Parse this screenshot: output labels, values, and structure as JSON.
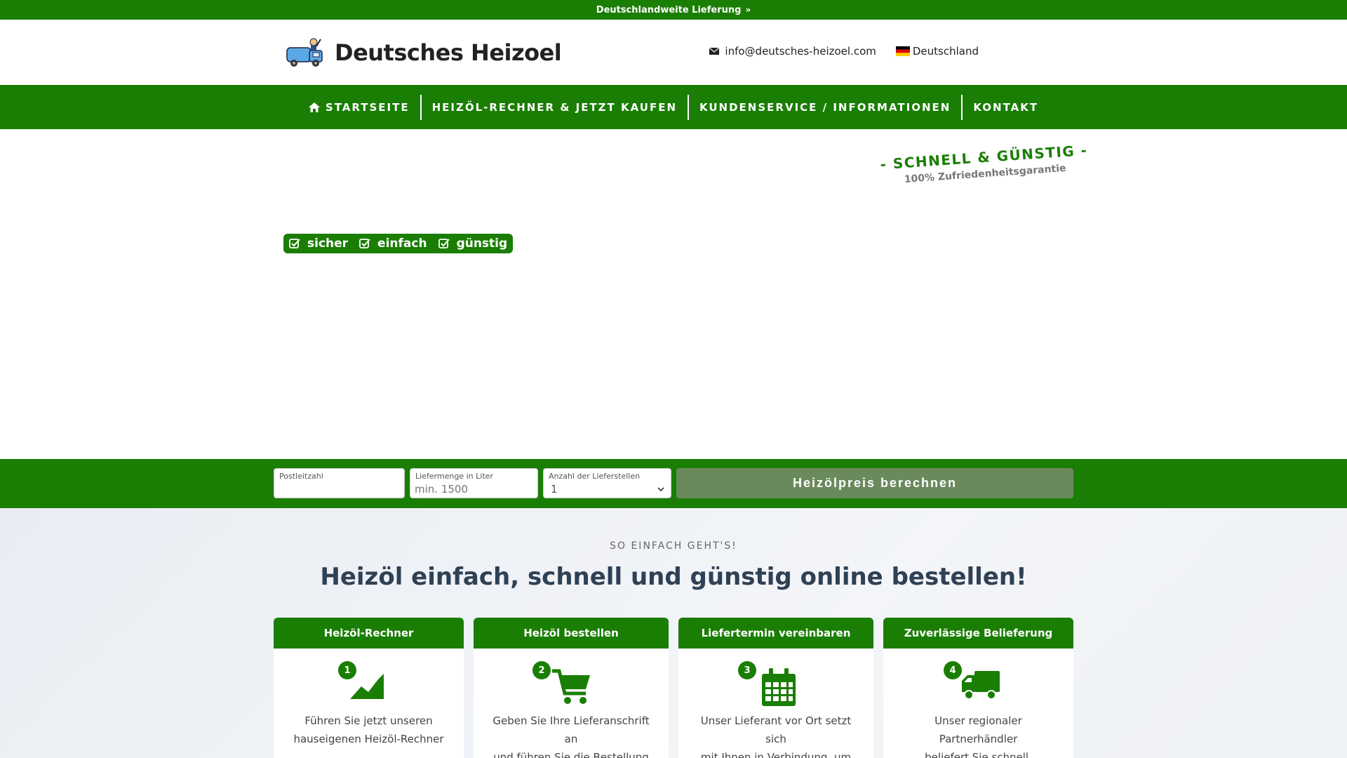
{
  "topbar": {
    "text": "Deutschlandweite Lieferung"
  },
  "header": {
    "brand": "Deutsches Heizoel",
    "email": "info@deutsches-heizoel.com",
    "country": "Deutschland"
  },
  "nav": {
    "items": [
      {
        "label": "STARTSEITE"
      },
      {
        "label": "HEIZÖL-RECHNER & JETZT KAUFEN"
      },
      {
        "label": "KUNDENSERVICE / INFORMATIONEN"
      },
      {
        "label": "KONTAKT"
      }
    ]
  },
  "hero": {
    "slogan_main": "- SCHNELL & GÜNSTIG -",
    "slogan_sub": "100% Zufriedenheitsgarantie",
    "badges": [
      "sicher",
      "einfach",
      "günstig"
    ]
  },
  "calculator": {
    "postal_label": "Postleitzahl",
    "postal_value": "",
    "amount_label": "Liefermenge in Liter",
    "amount_placeholder": "min. 1500",
    "stations_label": "Anzahl der Lieferstellen",
    "stations_value": "1",
    "button_label": "Heizölpreis berechnen"
  },
  "steps": {
    "eyebrow": "SO EINFACH GEHT'S!",
    "headline": "Heizöl einfach, schnell und günstig online bestellen!",
    "cards": [
      {
        "number": "1",
        "title": "Heizöl-Rechner",
        "icon": "area-chart-icon",
        "line1": "Führen Sie jetzt unseren",
        "line2": "hauseigenen Heizöl-Rechner"
      },
      {
        "number": "2",
        "title": "Heizöl bestellen",
        "icon": "shopping-cart-icon",
        "line1": "Geben Sie Ihre Lieferanschrift an",
        "line2": "und führen Sie die Bestellung"
      },
      {
        "number": "3",
        "title": "Liefertermin vereinbaren",
        "icon": "calendar-icon",
        "line1": "Unser Lieferant vor Ort setzt sich",
        "line2": "mit Ihnen in Verbindung, um einen"
      },
      {
        "number": "4",
        "title": "Zuverlässige Belieferung",
        "icon": "truck-icon",
        "line1": "Unser regionaler Partnerhändler",
        "line2": "beliefert Sie schnell, zuverlässig"
      }
    ]
  },
  "colors": {
    "brand_green": "#1a7e04",
    "button_muted": "#6a8a5e",
    "headline": "#2f4154"
  }
}
